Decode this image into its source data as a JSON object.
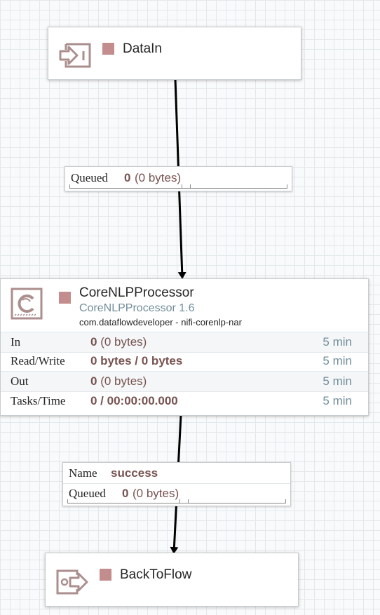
{
  "input_port": {
    "name": "DataIn",
    "icon": "input-port-icon",
    "status": "stopped",
    "status_color": "#c28d8c"
  },
  "connection_in": {
    "queued_label": "Queued",
    "queued_count": "0",
    "queued_size": "(0 bytes)"
  },
  "processor": {
    "name": "CoreNLPProcessor",
    "type": "CoreNLPProcessor 1.6",
    "bundle": "com.dataflowdeveloper - nifi-corenlp-nar",
    "icon": "processor-icon",
    "status": "stopped",
    "status_color": "#c28d8c",
    "stats": [
      {
        "label": "In",
        "value": "0",
        "detail": "(0 bytes)",
        "window": "5 min"
      },
      {
        "label": "Read/Write",
        "value": "0 bytes / 0 bytes",
        "detail": "",
        "window": "5 min"
      },
      {
        "label": "Out",
        "value": "0",
        "detail": "(0 bytes)",
        "window": "5 min"
      },
      {
        "label": "Tasks/Time",
        "value": "0 / 00:00:00.000",
        "detail": "",
        "window": "5 min"
      }
    ]
  },
  "connection_out": {
    "name_label": "Name",
    "name_value": "success",
    "queued_label": "Queued",
    "queued_count": "0",
    "queued_size": "(0 bytes)"
  },
  "output_port": {
    "name": "BackToFlow",
    "icon": "output-port-icon",
    "status": "stopped",
    "status_color": "#c28d8c"
  },
  "colors": {
    "accent_value": "#775351",
    "type_text": "#728e9b",
    "stopped": "#c28d8c",
    "icon_stroke": "#ab8f8e"
  }
}
